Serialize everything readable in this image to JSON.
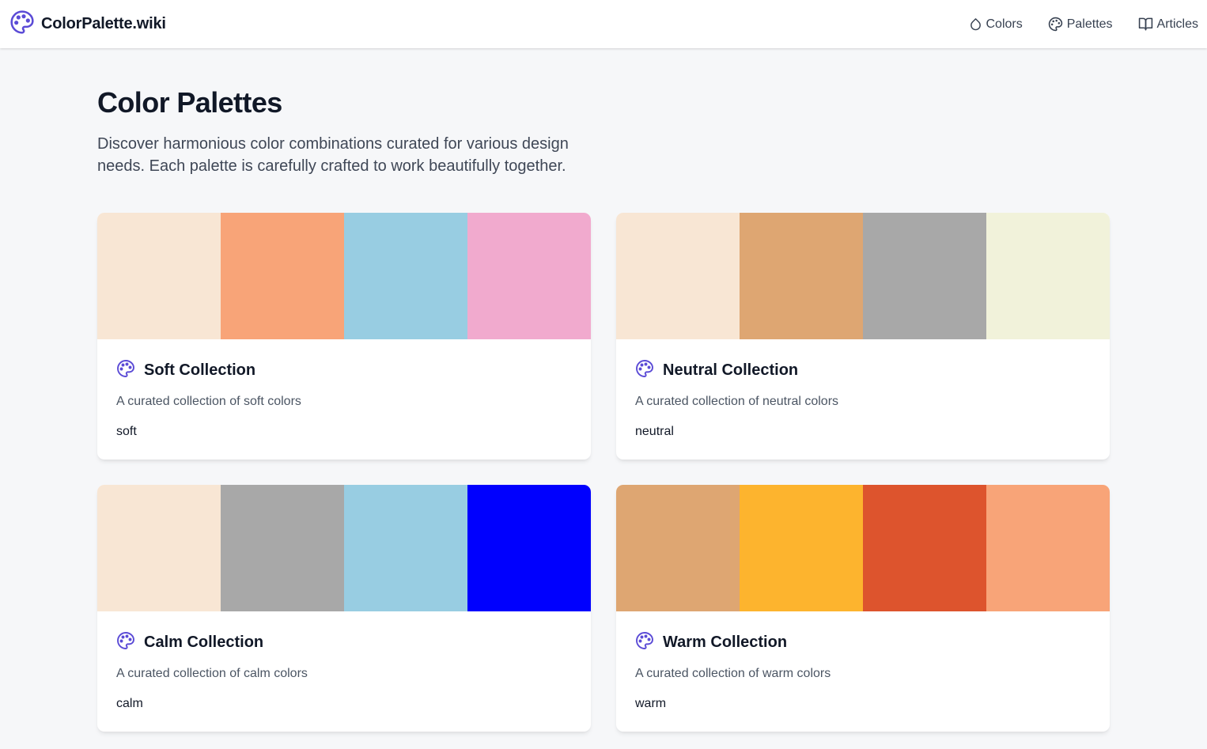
{
  "header": {
    "brand_name": "ColorPalette.wiki",
    "brand_icon": "palette-icon",
    "nav": [
      {
        "label": "Colors",
        "icon": "droplet-icon"
      },
      {
        "label": "Palettes",
        "icon": "palette-icon"
      },
      {
        "label": "Articles",
        "icon": "book-open-icon"
      }
    ]
  },
  "page": {
    "title": "Color Palettes",
    "description": "Discover harmonious color combinations curated for various design needs. Each palette is carefully crafted to work beautifully together."
  },
  "accent_color": "#5b4bd6",
  "palettes": [
    {
      "title": "Soft Collection",
      "description": "A curated collection of soft colors",
      "tag": "soft",
      "colors": [
        "#f8e6d4",
        "#f8a478",
        "#98cde2",
        "#f1aace"
      ]
    },
    {
      "title": "Neutral Collection",
      "description": "A curated collection of neutral colors",
      "tag": "neutral",
      "colors": [
        "#f8e6d4",
        "#dea672",
        "#a8a8a8",
        "#f1f2da"
      ]
    },
    {
      "title": "Calm Collection",
      "description": "A curated collection of calm colors",
      "tag": "calm",
      "colors": [
        "#f8e6d4",
        "#a8a8a8",
        "#98cde2",
        "#0000fe"
      ]
    },
    {
      "title": "Warm Collection",
      "description": "A curated collection of warm colors",
      "tag": "warm",
      "colors": [
        "#dea672",
        "#fdb42e",
        "#dd542d",
        "#f8a478"
      ]
    }
  ]
}
